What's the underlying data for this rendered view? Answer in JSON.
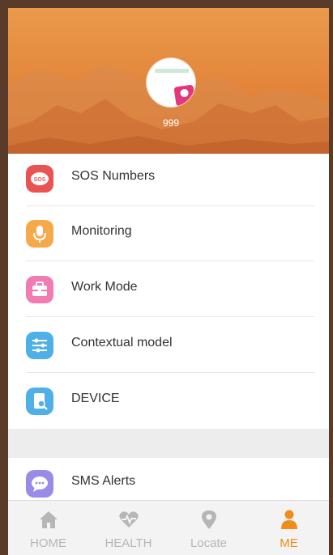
{
  "profile": {
    "username": "999"
  },
  "menu": {
    "items": [
      {
        "label": "SOS Numbers",
        "icon": "sos-icon",
        "color": "#e95453"
      },
      {
        "label": "Monitoring",
        "icon": "microphone-icon",
        "color": "#f6a94a"
      },
      {
        "label": "Work Mode",
        "icon": "briefcase-icon",
        "color": "#f07cb2"
      },
      {
        "label": "Contextual model",
        "icon": "sliders-icon",
        "color": "#4fb0e8"
      },
      {
        "label": "DEVICE",
        "icon": "device-search-icon",
        "color": "#4fb0e8"
      },
      {
        "label": "SMS Alerts",
        "icon": "message-icon",
        "color": "#9b8be8"
      }
    ],
    "sos_badge": "SOS"
  },
  "nav": {
    "tabs": [
      {
        "label": "HOME",
        "icon": "home-icon",
        "active": false
      },
      {
        "label": "HEALTH",
        "icon": "heart-pulse-icon",
        "active": false
      },
      {
        "label": "Locate",
        "icon": "location-pin-icon",
        "active": false
      },
      {
        "label": "ME",
        "icon": "person-icon",
        "active": true
      }
    ]
  },
  "colors": {
    "accent": "#f08c1a",
    "header": "#e3853a",
    "inactive": "#b6b6b6"
  }
}
